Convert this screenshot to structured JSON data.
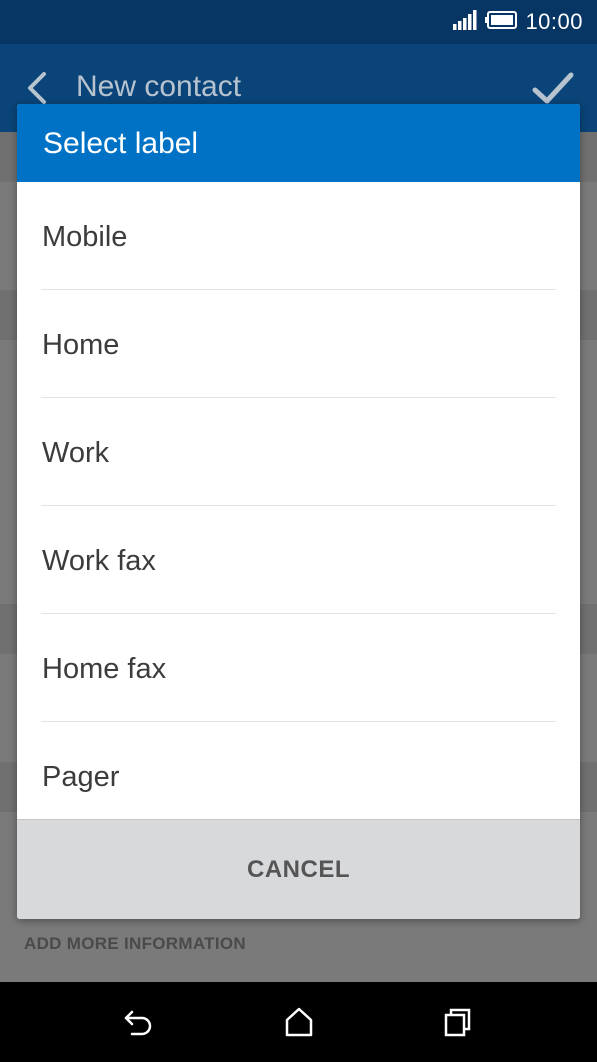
{
  "status_bar": {
    "time": "10:00",
    "icons": [
      "signal-icon",
      "battery-icon"
    ]
  },
  "app_bar": {
    "title": "New contact",
    "icons": [
      "back-icon",
      "check-icon"
    ]
  },
  "background": {
    "add_more_label": "ADD MORE INFORMATION"
  },
  "dialog": {
    "title": "Select label",
    "options": [
      "Mobile",
      "Home",
      "Work",
      "Work fax",
      "Home fax",
      "Pager"
    ],
    "cancel_label": "CANCEL"
  },
  "nav_bar": {
    "icons": [
      "back-nav-icon",
      "home-icon",
      "recents-icon"
    ]
  },
  "colors": {
    "status_bar": "#073665",
    "app_bar": "#0a4478",
    "dialog_header": "#0072c6",
    "dialog_footer": "#d8d9db"
  }
}
